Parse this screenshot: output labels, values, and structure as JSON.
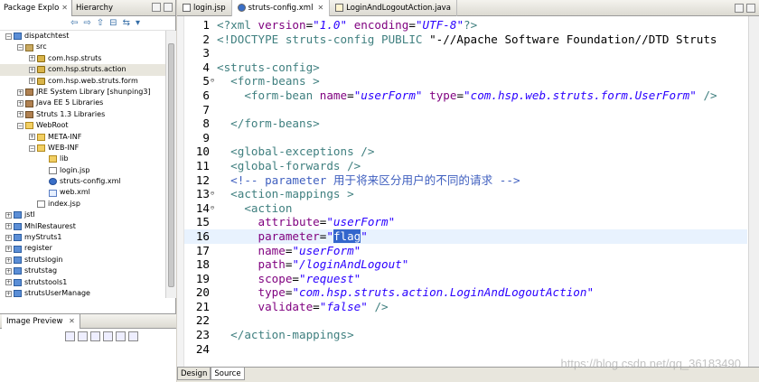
{
  "left_panel": {
    "tabs": [
      {
        "label": "Package Explo",
        "active": true
      },
      {
        "label": "Hierarchy",
        "active": false
      }
    ],
    "tree": [
      {
        "label": "dispatchtest",
        "indent": 0,
        "toggle": "-",
        "icon": "proj",
        "selected": false
      },
      {
        "label": "src",
        "indent": 1,
        "toggle": "-",
        "icon": "src",
        "selected": false
      },
      {
        "label": "com.hsp.struts",
        "indent": 2,
        "toggle": "+",
        "icon": "pkg",
        "selected": false
      },
      {
        "label": "com.hsp.struts.action",
        "indent": 2,
        "toggle": "+",
        "icon": "pkg",
        "selected": true
      },
      {
        "label": "com.hsp.web.struts.form",
        "indent": 2,
        "toggle": "+",
        "icon": "pkg",
        "selected": false
      },
      {
        "label": "JRE System Library [shunping3]",
        "indent": 1,
        "toggle": "+",
        "icon": "lib",
        "selected": false
      },
      {
        "label": "Java EE 5 Libraries",
        "indent": 1,
        "toggle": "+",
        "icon": "lib",
        "selected": false
      },
      {
        "label": "Struts 1.3 Libraries",
        "indent": 1,
        "toggle": "+",
        "icon": "lib",
        "selected": false
      },
      {
        "label": "WebRoot",
        "indent": 1,
        "toggle": "-",
        "icon": "folder",
        "selected": false
      },
      {
        "label": "META-INF",
        "indent": 2,
        "toggle": "+",
        "icon": "folder",
        "selected": false
      },
      {
        "label": "WEB-INF",
        "indent": 2,
        "toggle": "-",
        "icon": "folder",
        "selected": false
      },
      {
        "label": "lib",
        "indent": 3,
        "toggle": "",
        "icon": "folder",
        "selected": false
      },
      {
        "label": "login.jsp",
        "indent": 3,
        "toggle": "",
        "icon": "file",
        "selected": false
      },
      {
        "label": "struts-config.xml",
        "indent": 3,
        "toggle": "",
        "icon": "gear",
        "selected": false
      },
      {
        "label": "web.xml",
        "indent": 3,
        "toggle": "",
        "icon": "xml",
        "selected": false
      },
      {
        "label": "index.jsp",
        "indent": 2,
        "toggle": "",
        "icon": "file",
        "selected": false
      },
      {
        "label": "jstl",
        "indent": 0,
        "toggle": "+",
        "icon": "proj",
        "selected": false
      },
      {
        "label": "MhlRestaurest",
        "indent": 0,
        "toggle": "+",
        "icon": "proj",
        "selected": false
      },
      {
        "label": "myStruts1",
        "indent": 0,
        "toggle": "+",
        "icon": "proj",
        "selected": false
      },
      {
        "label": "register",
        "indent": 0,
        "toggle": "+",
        "icon": "proj",
        "selected": false
      },
      {
        "label": "strutslogin",
        "indent": 0,
        "toggle": "+",
        "icon": "proj",
        "selected": false
      },
      {
        "label": "strutstag",
        "indent": 0,
        "toggle": "+",
        "icon": "proj",
        "selected": false
      },
      {
        "label": "strutstools1",
        "indent": 0,
        "toggle": "+",
        "icon": "proj",
        "selected": false
      },
      {
        "label": "strutsUserManage",
        "indent": 0,
        "toggle": "+",
        "icon": "proj",
        "selected": false
      }
    ],
    "preview_tab": "Image Preview"
  },
  "editor": {
    "tabs": [
      {
        "label": "login.jsp",
        "active": false,
        "icon": "file"
      },
      {
        "label": "struts-config.xml",
        "active": true,
        "icon": "gear"
      },
      {
        "label": "LoginAndLogoutAction.java",
        "active": false,
        "icon": "java"
      }
    ],
    "bottom_tabs": [
      {
        "label": "Design",
        "active": false
      },
      {
        "label": "Source",
        "active": true
      }
    ],
    "current_line": 16,
    "lines": [
      {
        "n": "1",
        "fold": "",
        "segs": [
          {
            "c": "tag",
            "t": "<?xml "
          },
          {
            "c": "attr",
            "t": "version"
          },
          {
            "c": "plain",
            "t": "="
          },
          {
            "c": "val",
            "t": "\"1.0\""
          },
          {
            "c": "plain",
            "t": " "
          },
          {
            "c": "attr",
            "t": "encoding"
          },
          {
            "c": "plain",
            "t": "="
          },
          {
            "c": "val",
            "t": "\"UTF-8\""
          },
          {
            "c": "tag",
            "t": "?>"
          }
        ]
      },
      {
        "n": "2",
        "fold": "",
        "segs": [
          {
            "c": "tag",
            "t": "<!DOCTYPE struts-config "
          },
          {
            "c": "kw",
            "t": "PUBLIC "
          },
          {
            "c": "plain",
            "t": "\"-//Apache Software Foundation//DTD Struts"
          }
        ]
      },
      {
        "n": "3",
        "fold": "",
        "segs": []
      },
      {
        "n": "4",
        "fold": "",
        "segs": [
          {
            "c": "tag",
            "t": "<struts-config>"
          }
        ]
      },
      {
        "n": "5",
        "fold": "⊖",
        "segs": [
          {
            "c": "plain",
            "t": "  "
          },
          {
            "c": "tag",
            "t": "<form-beans >"
          }
        ]
      },
      {
        "n": "6",
        "fold": "",
        "segs": [
          {
            "c": "plain",
            "t": "    "
          },
          {
            "c": "tag",
            "t": "<form-bean "
          },
          {
            "c": "attr",
            "t": "name"
          },
          {
            "c": "plain",
            "t": "="
          },
          {
            "c": "val",
            "t": "\"userForm\""
          },
          {
            "c": "plain",
            "t": " "
          },
          {
            "c": "attr",
            "t": "type"
          },
          {
            "c": "plain",
            "t": "="
          },
          {
            "c": "val",
            "t": "\"com.hsp.web.struts.form.UserForm\""
          },
          {
            "c": "plain",
            "t": " "
          },
          {
            "c": "tag",
            "t": "/>"
          }
        ]
      },
      {
        "n": "7",
        "fold": "",
        "segs": []
      },
      {
        "n": "8",
        "fold": "",
        "segs": [
          {
            "c": "plain",
            "t": "  "
          },
          {
            "c": "tag",
            "t": "</form-beans>"
          }
        ]
      },
      {
        "n": "9",
        "fold": "",
        "segs": []
      },
      {
        "n": "10",
        "fold": "",
        "segs": [
          {
            "c": "plain",
            "t": "  "
          },
          {
            "c": "tag",
            "t": "<global-exceptions />"
          }
        ]
      },
      {
        "n": "11",
        "fold": "",
        "segs": [
          {
            "c": "plain",
            "t": "  "
          },
          {
            "c": "tag",
            "t": "<global-forwards />"
          }
        ]
      },
      {
        "n": "12",
        "fold": "",
        "segs": [
          {
            "c": "plain",
            "t": "  "
          },
          {
            "c": "cmt",
            "t": "<!-- parameter 用于将来区分用户的不同的请求 -->"
          }
        ]
      },
      {
        "n": "13",
        "fold": "⊖",
        "segs": [
          {
            "c": "plain",
            "t": "  "
          },
          {
            "c": "tag",
            "t": "<action-mappings >"
          }
        ]
      },
      {
        "n": "14",
        "fold": "⊖",
        "segs": [
          {
            "c": "plain",
            "t": "    "
          },
          {
            "c": "tag",
            "t": "<action"
          }
        ]
      },
      {
        "n": "15",
        "fold": "",
        "segs": [
          {
            "c": "plain",
            "t": "      "
          },
          {
            "c": "attr",
            "t": "attribute"
          },
          {
            "c": "plain",
            "t": "="
          },
          {
            "c": "val",
            "t": "\"userForm\""
          }
        ]
      },
      {
        "n": "16",
        "fold": "",
        "segs": [
          {
            "c": "plain",
            "t": "      "
          },
          {
            "c": "attr",
            "t": "parameter"
          },
          {
            "c": "plain",
            "t": "="
          },
          {
            "c": "val",
            "t": "\""
          },
          {
            "c": "hl",
            "t": "flag"
          },
          {
            "c": "val",
            "t": "\""
          }
        ]
      },
      {
        "n": "17",
        "fold": "",
        "segs": [
          {
            "c": "plain",
            "t": "      "
          },
          {
            "c": "attr",
            "t": "name"
          },
          {
            "c": "plain",
            "t": "="
          },
          {
            "c": "val",
            "t": "\"userForm\""
          }
        ]
      },
      {
        "n": "18",
        "fold": "",
        "segs": [
          {
            "c": "plain",
            "t": "      "
          },
          {
            "c": "attr",
            "t": "path"
          },
          {
            "c": "plain",
            "t": "="
          },
          {
            "c": "val",
            "t": "\"/loginAndLogout\""
          }
        ]
      },
      {
        "n": "19",
        "fold": "",
        "segs": [
          {
            "c": "plain",
            "t": "      "
          },
          {
            "c": "attr",
            "t": "scope"
          },
          {
            "c": "plain",
            "t": "="
          },
          {
            "c": "val",
            "t": "\"request\""
          }
        ]
      },
      {
        "n": "20",
        "fold": "",
        "segs": [
          {
            "c": "plain",
            "t": "      "
          },
          {
            "c": "attr",
            "t": "type"
          },
          {
            "c": "plain",
            "t": "="
          },
          {
            "c": "val",
            "t": "\"com.hsp.struts.action.LoginAndLogoutAction\""
          }
        ]
      },
      {
        "n": "21",
        "fold": "",
        "segs": [
          {
            "c": "plain",
            "t": "      "
          },
          {
            "c": "attr",
            "t": "validate"
          },
          {
            "c": "plain",
            "t": "="
          },
          {
            "c": "val",
            "t": "\"false\""
          },
          {
            "c": "plain",
            "t": " "
          },
          {
            "c": "tag",
            "t": "/>"
          }
        ]
      },
      {
        "n": "22",
        "fold": "",
        "segs": []
      },
      {
        "n": "23",
        "fold": "",
        "segs": [
          {
            "c": "plain",
            "t": "  "
          },
          {
            "c": "tag",
            "t": "</action-mappings>"
          }
        ]
      },
      {
        "n": "24",
        "fold": "",
        "segs": []
      }
    ]
  },
  "watermark": "https://blog.csdn.net/qq_36183490"
}
